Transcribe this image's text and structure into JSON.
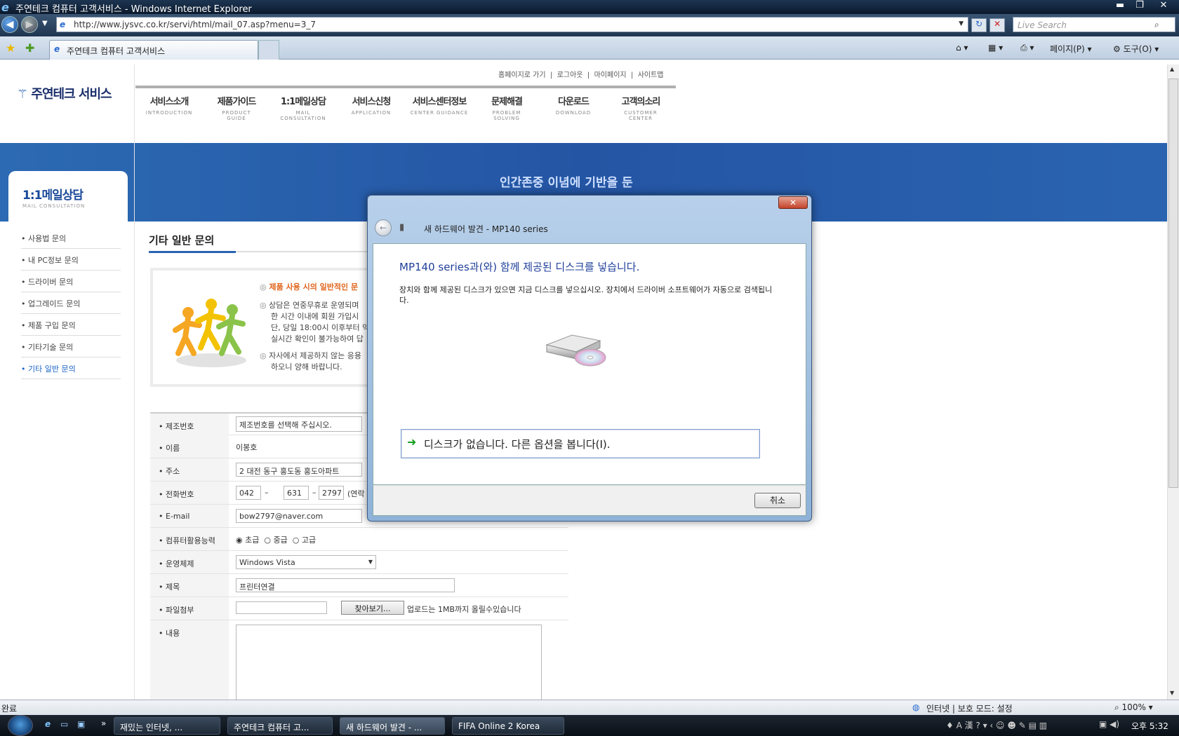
{
  "browser": {
    "window_title": "주연테크 컴퓨터 고객서비스 - Windows Internet Explorer",
    "url": "http://www.jysvc.co.kr/servi/html/mail_07.asp?menu=3_7",
    "search_placeholder": "Live Search",
    "tab_title": "주연테크 컴퓨터 고객서비스",
    "page_menu": "페이지(P)",
    "tools_menu": "도구(O)",
    "status": "완료",
    "zone": "인터넷 | 보호 모드: 설정",
    "zoom": "100%"
  },
  "site": {
    "logo": "주연테크 서비스",
    "top_links": [
      "홈페이지로 가기",
      "로그아웃",
      "마이페이지",
      "사이트맵"
    ],
    "nav": [
      {
        "ko": "서비스소개",
        "en": "INTRODUCTION"
      },
      {
        "ko": "제품가이드",
        "en": "PRODUCT GUIDE"
      },
      {
        "ko": "1:1메일상담",
        "en": "MAIL CONSULTATION"
      },
      {
        "ko": "서비스신청",
        "en": "APPLICATION"
      },
      {
        "ko": "서비스센터정보",
        "en": "CENTER GUIDANCE"
      },
      {
        "ko": "문제해결",
        "en": "PROBLEM SOLVING"
      },
      {
        "ko": "다운로드",
        "en": "DOWNLOAD"
      },
      {
        "ko": "고객의소리",
        "en": "CUSTOMER CENTER"
      }
    ],
    "banner_text": "인간존중 이념에 기반을 둔",
    "side_title": "1:1메일상담",
    "side_subtitle": "MAIL CONSULTATION",
    "side_items": [
      "사용법 문의",
      "내 PC정보 문의",
      "드라이버 문의",
      "업그레이드 문의",
      "제품 구입 문의",
      "기타기술 문의",
      "기타 일반 문의"
    ],
    "page_title": "기타 일반 문의",
    "notice": {
      "heading": "제품 사용 시의 일반적인 문",
      "lines1": [
        "상담은 연중무휴로 운영되며",
        "한 시간 이내에 회원 가입시",
        "단, 당일 18:00시 이후부터 익",
        "실시간 확인이 불가능하여 답"
      ],
      "lines2": [
        "자사에서 제공하지 않는 응용",
        "하오니 양해 바랍니다."
      ]
    },
    "form": {
      "serial_label": "제조번호",
      "serial_value": "제조번호를 선택해 주십시오.",
      "name_label": "이름",
      "name_value": "이봉호",
      "addr_label": "주소",
      "addr_value": "2 대전 동구 홍도동 홍도아파트",
      "phone_label": "전화번호",
      "phone1": "042",
      "phone2": "631",
      "phone3": "2797",
      "phone_note": "(연락",
      "email_label": "E-mail",
      "email_value": "bow2797@naver.com",
      "skill_label": "컴퓨터활용능력",
      "skill_opts": [
        "초급",
        "중급",
        "고급"
      ],
      "os_label": "운영체제",
      "os_value": "Windows Vista",
      "subject_label": "제목",
      "subject_value": "프린터연결",
      "file_label": "파일첨부",
      "file_button": "찾아보기...",
      "file_note": "업로드는 1MB까지 올릴수있습니다",
      "content_label": "내용"
    }
  },
  "dialog": {
    "title": "새 하드웨어 발견 - MP140 series",
    "heading": "MP140 series과(와) 함께 제공된 디스크를 넣습니다.",
    "description": "장치와 함께 제공된 디스크가 있으면 지금 디스크를 넣으십시오. 장치에서 드라이버 소프트웨어가 자동으로 검색됩니다.",
    "option": "디스크가 없습니다. 다른 옵션을 봅니다(I).",
    "cancel": "취소"
  },
  "taskbar": {
    "tasks": [
      "재밌는 인터넷, ...",
      "주연테크 컴퓨터 고...",
      "새 하드웨어 발견 - ...",
      "FIFA Online 2 Korea"
    ],
    "clock": "오후 5:32"
  }
}
